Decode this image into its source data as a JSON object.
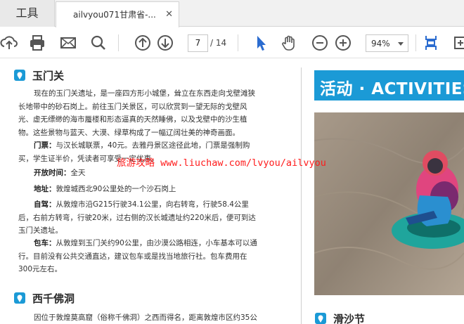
{
  "tabs": {
    "tools_label": "工具",
    "doc_title": "ailvyou071甘肃省-...",
    "close_glyph": "✕"
  },
  "toolbar": {
    "page_current": "7",
    "page_total": "/ 14",
    "zoom": "94%",
    "icons": [
      "upload-icon",
      "print-icon",
      "mail-icon",
      "search-icon",
      "page-up-icon",
      "page-down-icon",
      "select-cursor-icon",
      "hand-tool-icon",
      "zoom-out-icon",
      "zoom-in-icon",
      "page-fit-icon",
      "more-icon"
    ]
  },
  "watermark": "旅游攻略 www.liuchaw.com/lvyou/ailvyou",
  "left_page": {
    "section1": {
      "title": "玉门关",
      "intro": [
        "现在的玉门关遗址，是一座四方形小城堡，耸立在东西走向戈壁滩狭",
        "长地带中的砂石岗上。前往玉门关景区，可以欣赏到一望无际的戈壁风",
        "光、虚无缥缈的海市蜃楼和形态逼真的天然睡佛，以及戈壁中的沙生植",
        "物。这些景物与蓝天、大漠、绿草构成了一幅辽阔壮美的神奇画面。"
      ],
      "ticket_label": "门票：",
      "ticket_text": [
        "与汉长城联票，40元。去雅丹景区途径此地，门票是强制购",
        "买，学生证半价，凭读者可享受一定优惠。"
      ],
      "hours_label": "开放时间：",
      "hours_text": "全天",
      "address_label": "地址：",
      "address_text": "敦煌城西北90公里处的一个沙石岗上",
      "drive_label": "自驾：",
      "drive_text": [
        "从敦煌市沿G215行驶34.1公里，向右转弯，行驶58.4公里",
        "后，右前方转弯，行驶20米，过右侧的汉长城遗址约220米后，便可到达",
        "玉门关遗址。"
      ],
      "bus_label": "包车：",
      "bus_text": [
        "从敦煌到玉门关约90公里，由沙漠公路相连，小车基本可以通",
        "行。目前没有公共交通直达，建议包车或是找当地旅行社。包车费用在",
        "300元左右。"
      ]
    },
    "section2": {
      "title": "西千佛洞",
      "intro": "因位于敦煌莫高窟（俗称千佛洞）之西而得名，距离敦煌市区约35公"
    }
  },
  "right_page": {
    "banner": "活动 · ACTIVITIES",
    "section_title": "滑沙节"
  },
  "colors": {
    "accent_blue": "#1b9ad6",
    "watermark_red": "#ff1b1b",
    "icon_grey": "#555555",
    "cursor_blue": "#2b6cd0"
  }
}
